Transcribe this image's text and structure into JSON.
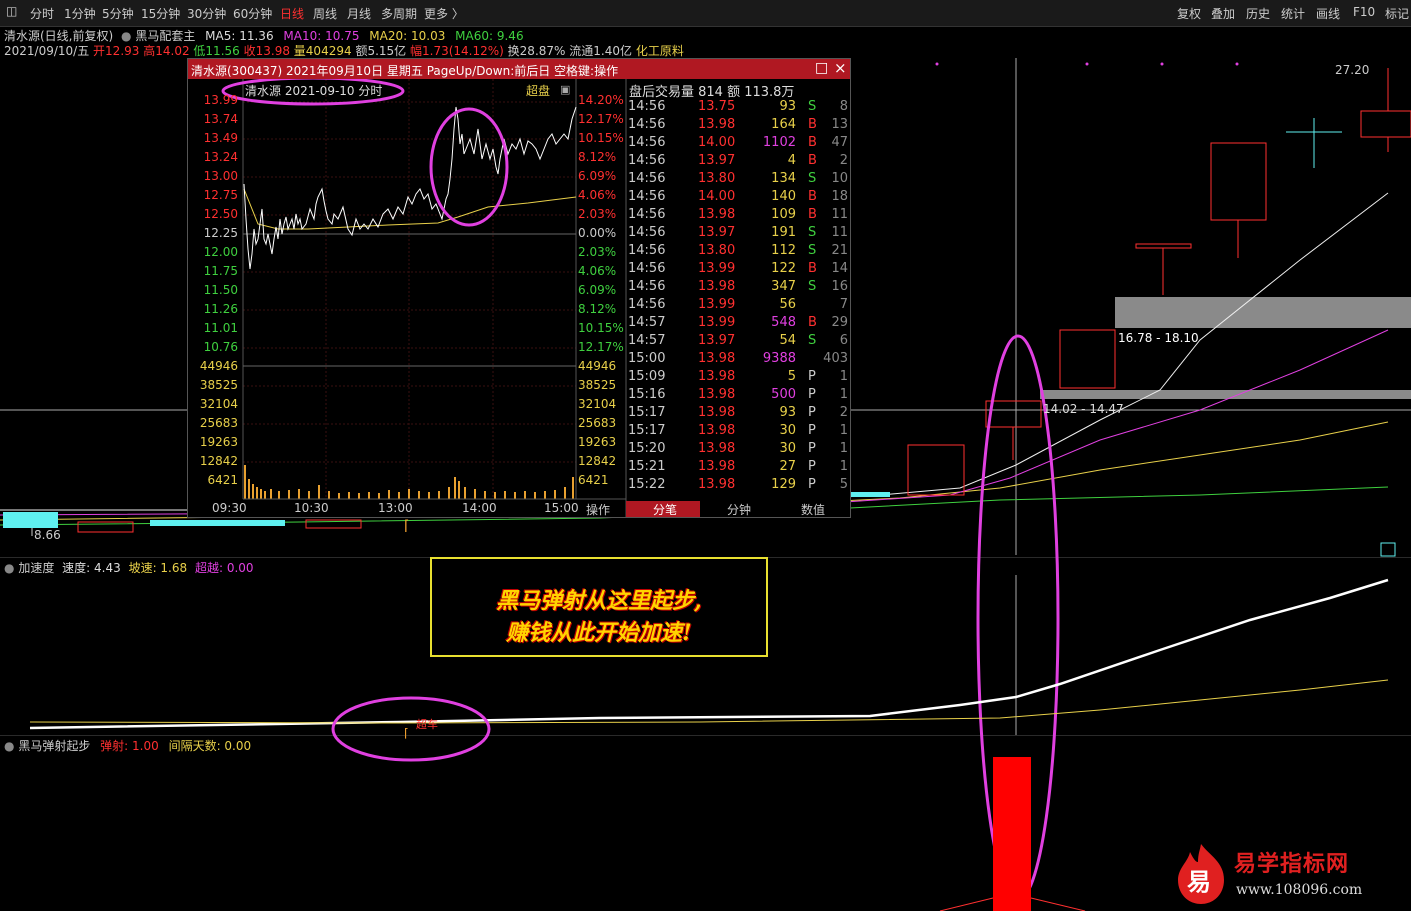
{
  "toolbar": {
    "periods": [
      "分时",
      "1分钟",
      "5分钟",
      "15分钟",
      "30分钟",
      "60分钟",
      "日线",
      "周线",
      "月线",
      "多周期",
      "更多 〉"
    ],
    "active_period": "日线",
    "right_tools": [
      "复权",
      "叠加",
      "历史",
      "统计",
      "画线",
      "F10",
      "标记"
    ]
  },
  "header": {
    "stock": "清水源(日线,前复权)",
    "indicator": "黑马配套主",
    "ma5": "MA5: 11.36",
    "ma10": "MA10: 10.75",
    "ma20": "MA20: 10.03",
    "ma60": "MA60: 9.46",
    "date": "2021/09/10/五",
    "open": "开12.93",
    "high": "高14.02",
    "low": "低11.56",
    "close": "收13.98",
    "volume": "量404294",
    "amount": "额5.15亿",
    "amplitude": "幅1.73(14.12%)",
    "turnover": "换28.87%",
    "float": "流通1.40亿",
    "sector": "化工原料"
  },
  "main_chart": {
    "high_label": "27.20",
    "low_label": "8.66",
    "zone1": "16.78 - 18.10",
    "zone2": "14.02 - 14.47"
  },
  "popup": {
    "title": "清水源(300437) 2021年09月10日 星期五 PageUp/Down:前后日 空格键:操作",
    "subtitle": "清水源  2021-09-10 分时",
    "chaopan": "超盘",
    "left_prices": [
      "13.99",
      "13.74",
      "13.49",
      "13.24",
      "13.00",
      "12.75",
      "12.50",
      "12.25",
      "12.00",
      "11.75",
      "11.50",
      "11.26",
      "11.01",
      "10.76"
    ],
    "right_pct": [
      "14.20%",
      "12.17%",
      "10.15%",
      "8.12%",
      "6.09%",
      "4.06%",
      "2.03%",
      "0.00%",
      "2.03%",
      "4.06%",
      "6.09%",
      "8.12%",
      "10.15%",
      "12.17%"
    ],
    "vol_labels": [
      "44946",
      "38525",
      "32104",
      "25683",
      "19263",
      "12842",
      "6421"
    ],
    "time_labels": [
      "09:30",
      "10:30",
      "13:00",
      "14:00",
      "15:00"
    ],
    "op_label": "操作",
    "trade_header": "盘后交易量 814 额 113.8万",
    "trades": [
      {
        "t": "14:56",
        "p": "13.75",
        "v": "93",
        "d": "S",
        "n": "8"
      },
      {
        "t": "14:56",
        "p": "13.98",
        "v": "164",
        "d": "B",
        "n": "13"
      },
      {
        "t": "14:56",
        "p": "14.00",
        "v": "1102",
        "d": "B",
        "n": "47"
      },
      {
        "t": "14:56",
        "p": "13.97",
        "v": "4",
        "d": "B",
        "n": "2"
      },
      {
        "t": "14:56",
        "p": "13.80",
        "v": "134",
        "d": "S",
        "n": "10"
      },
      {
        "t": "14:56",
        "p": "14.00",
        "v": "140",
        "d": "B",
        "n": "18"
      },
      {
        "t": "14:56",
        "p": "13.98",
        "v": "109",
        "d": "B",
        "n": "11"
      },
      {
        "t": "14:56",
        "p": "13.97",
        "v": "191",
        "d": "S",
        "n": "11"
      },
      {
        "t": "14:56",
        "p": "13.80",
        "v": "112",
        "d": "S",
        "n": "21"
      },
      {
        "t": "14:56",
        "p": "13.99",
        "v": "122",
        "d": "B",
        "n": "14"
      },
      {
        "t": "14:56",
        "p": "13.98",
        "v": "347",
        "d": "S",
        "n": "16"
      },
      {
        "t": "14:56",
        "p": "13.99",
        "v": "56",
        "d": "",
        "n": "7"
      },
      {
        "t": "14:57",
        "p": "13.99",
        "v": "548",
        "d": "B",
        "n": "29"
      },
      {
        "t": "14:57",
        "p": "13.97",
        "v": "54",
        "d": "S",
        "n": "6"
      },
      {
        "t": "15:00",
        "p": "13.98",
        "v": "9388",
        "d": "",
        "n": "403"
      },
      {
        "t": "15:09",
        "p": "13.98",
        "v": "5",
        "d": "P",
        "n": "1"
      },
      {
        "t": "15:16",
        "p": "13.98",
        "v": "500",
        "d": "P",
        "n": "1"
      },
      {
        "t": "15:17",
        "p": "13.98",
        "v": "93",
        "d": "P",
        "n": "2"
      },
      {
        "t": "15:17",
        "p": "13.98",
        "v": "30",
        "d": "P",
        "n": "1"
      },
      {
        "t": "15:20",
        "p": "13.98",
        "v": "30",
        "d": "P",
        "n": "1"
      },
      {
        "t": "15:21",
        "p": "13.98",
        "v": "27",
        "d": "P",
        "n": "1"
      },
      {
        "t": "15:22",
        "p": "13.98",
        "v": "129",
        "d": "P",
        "n": "5"
      }
    ],
    "tabs": [
      "分笔",
      "分钟",
      "数值"
    ]
  },
  "annotation": {
    "line1": "黑马弹射从这里起步,",
    "line2": "赚钱从此开始加速!"
  },
  "indicator1": {
    "name": "加速度",
    "speed": "速度: 4.43",
    "slope": "坡速: 1.68",
    "over": "超越: 0.00",
    "mark": "超车"
  },
  "indicator2": {
    "name": "黑马弹射起步",
    "eject": "弹射: 1.00",
    "interval": "间隔天数: 0.00"
  },
  "watermark": {
    "glyph": "易",
    "name": "易学指标网",
    "url": "www.108096.com"
  },
  "colors": {
    "up": "#ff3030",
    "down": "#3fd03f",
    "yellow": "#e8d04a",
    "magenta": "#e040e0"
  }
}
